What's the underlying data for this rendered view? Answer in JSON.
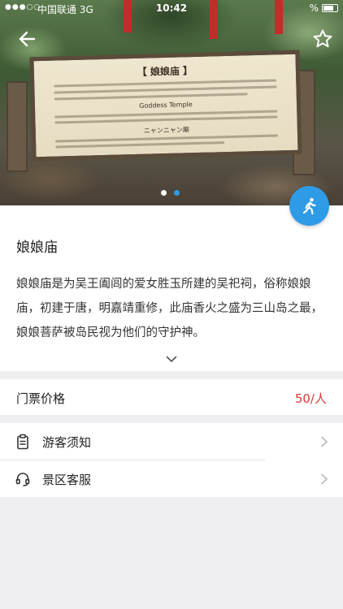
{
  "status_bar": {
    "signal": "●●●○○",
    "carrier": "中国联通  3G",
    "time": "10:42",
    "battery_pct": "%"
  },
  "hero": {
    "sign_title": "【 娘娘庙 】",
    "sign_subtitle_en": "Goddess Temple",
    "sign_subtitle_jp": "ニャンニャン廟",
    "carousel": {
      "count": 2,
      "active_index": 1
    }
  },
  "nav": {
    "back_icon": "back-arrow-icon",
    "favorite_icon": "star-outline-icon"
  },
  "fab": {
    "icon": "walking-person-icon",
    "color": "#2e9be6"
  },
  "attraction": {
    "title": "娘娘庙",
    "description": "娘娘庙是为吴王阖闾的爱女胜玉所建的吴祀祠，俗称娘娘庙，初建于唐，明嘉靖重修，此庙香火之盛为三山岛之最，娘娘菩萨被岛民视为他们的守护神。",
    "expand_icon": "chevron-down-icon"
  },
  "ticket": {
    "label": "门票价格",
    "price": "50/人",
    "price_color": "#d63a3a"
  },
  "list": [
    {
      "label": "游客须知",
      "icon": "clipboard-icon"
    },
    {
      "label": "景区客服",
      "icon": "headset-icon"
    }
  ]
}
